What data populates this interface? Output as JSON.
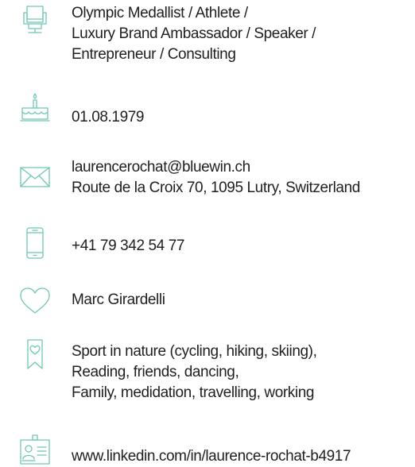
{
  "profile": {
    "profession": [
      "Olympic Medallist / Athlete /",
      "Luxury Brand Ambassador / Speaker /",
      "Entrepreneur / Consulting"
    ],
    "birthdate": "01.08.1979",
    "contact": [
      "laurencerochat@bluewin.ch",
      "Route de la Croix 70, 1095 Lutry, Switzerland"
    ],
    "phone": "+41 79 342 54 77",
    "partner": "Marc Girardelli",
    "interests": [
      "Sport in nature (cycling, hiking, skiing),",
      "Reading, friends, dancing,",
      "Family, medidation, travelling, working"
    ],
    "linkedin": "www.linkedin.com/in/laurence-rochat-b4917"
  },
  "icons": {
    "profession": "chair-icon",
    "birthdate": "birthday-cake-icon",
    "contact": "envelope-icon",
    "phone": "smartphone-icon",
    "partner": "heart-icon",
    "interests": "bookmark-heart-icon",
    "linkedin": "id-card-icon"
  },
  "colors": {
    "icon": "#6fc8b5",
    "text": "#1f1f1f",
    "background": "#ffffff"
  }
}
